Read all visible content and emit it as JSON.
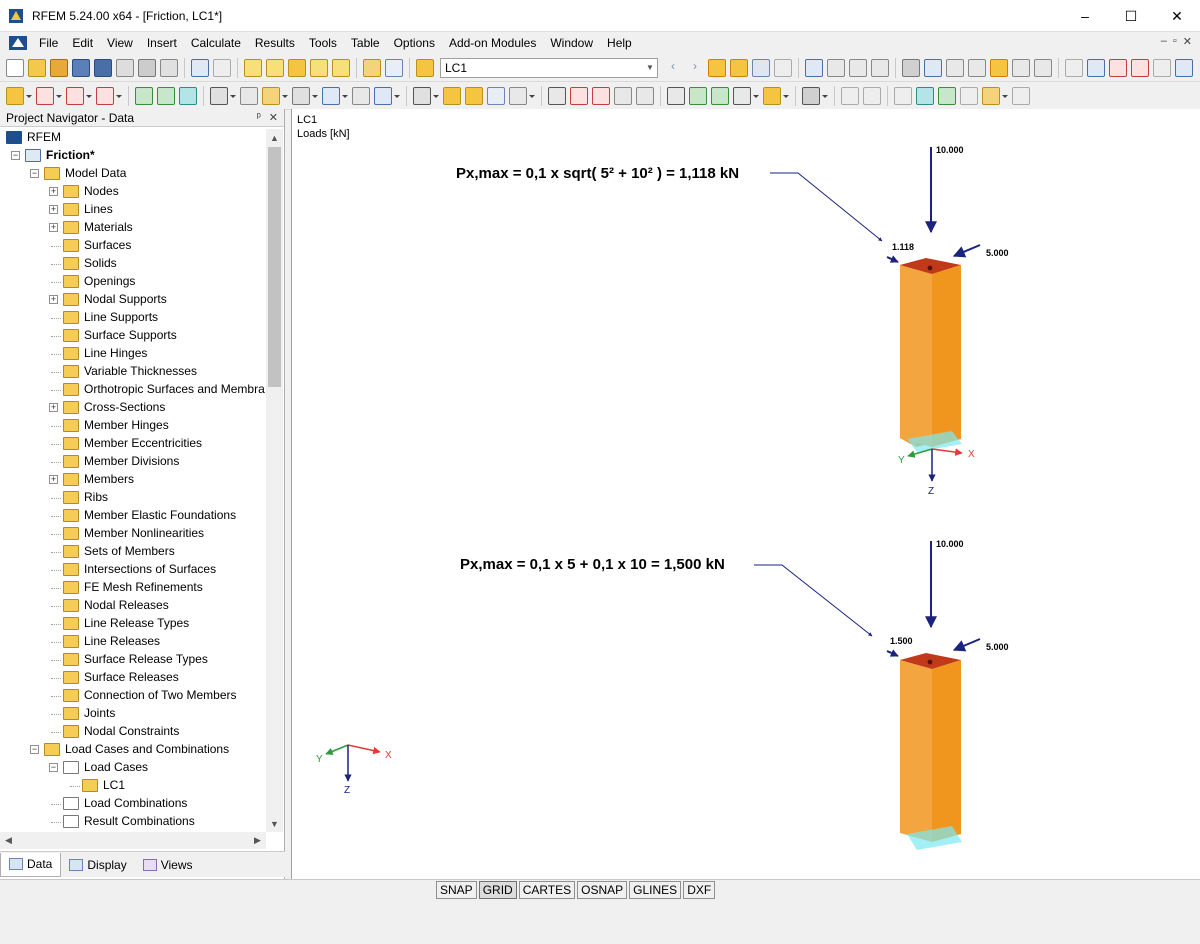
{
  "window": {
    "title": "RFEM 5.24.00 x64 - [Friction, LC1*]",
    "controls": [
      "–",
      "☐",
      "✕"
    ]
  },
  "menu": {
    "items": [
      "File",
      "Edit",
      "View",
      "Insert",
      "Calculate",
      "Results",
      "Tools",
      "Table",
      "Options",
      "Add-on Modules",
      "Window",
      "Help"
    ],
    "mdi": [
      "–",
      "▫",
      "✕"
    ]
  },
  "toolbar": {
    "load_case": "LC1"
  },
  "navigator": {
    "title": "Project Navigator - Data",
    "head_buttons": [
      "ᵖ",
      "✕"
    ],
    "tree": [
      {
        "label": "RFEM",
        "level": 0,
        "icon": "rfem-logo-icon",
        "expander": ""
      },
      {
        "label": "Friction*",
        "level": 1,
        "icon": "model-icon",
        "expander": "−",
        "bold": true
      },
      {
        "label": "Model Data",
        "level": 2,
        "icon": "folder-icon",
        "expander": "−"
      },
      {
        "label": "Nodes",
        "level": 3,
        "icon": "nodes-icon",
        "expander": "+"
      },
      {
        "label": "Lines",
        "level": 3,
        "icon": "lines-icon",
        "expander": "+"
      },
      {
        "label": "Materials",
        "level": 3,
        "icon": "materials-icon",
        "expander": "+"
      },
      {
        "label": "Surfaces",
        "level": 3,
        "icon": "surfaces-icon",
        "expander": ""
      },
      {
        "label": "Solids",
        "level": 3,
        "icon": "solids-icon",
        "expander": ""
      },
      {
        "label": "Openings",
        "level": 3,
        "icon": "openings-icon",
        "expander": ""
      },
      {
        "label": "Nodal Supports",
        "level": 3,
        "icon": "nodal-supports-icon",
        "expander": "+"
      },
      {
        "label": "Line Supports",
        "level": 3,
        "icon": "line-supports-icon",
        "expander": ""
      },
      {
        "label": "Surface Supports",
        "level": 3,
        "icon": "surface-supports-icon",
        "expander": ""
      },
      {
        "label": "Line Hinges",
        "level": 3,
        "icon": "line-hinges-icon",
        "expander": ""
      },
      {
        "label": "Variable Thicknesses",
        "level": 3,
        "icon": "variable-thickness-icon",
        "expander": ""
      },
      {
        "label": "Orthotropic Surfaces and Membra",
        "level": 3,
        "icon": "orthotropic-icon",
        "expander": ""
      },
      {
        "label": "Cross-Sections",
        "level": 3,
        "icon": "cross-sections-icon",
        "expander": "+"
      },
      {
        "label": "Member Hinges",
        "level": 3,
        "icon": "member-hinges-icon",
        "expander": ""
      },
      {
        "label": "Member Eccentricities",
        "level": 3,
        "icon": "member-eccentricities-icon",
        "expander": ""
      },
      {
        "label": "Member Divisions",
        "level": 3,
        "icon": "member-divisions-icon",
        "expander": ""
      },
      {
        "label": "Members",
        "level": 3,
        "icon": "members-icon",
        "expander": "+"
      },
      {
        "label": "Ribs",
        "level": 3,
        "icon": "ribs-icon",
        "expander": ""
      },
      {
        "label": "Member Elastic Foundations",
        "level": 3,
        "icon": "elastic-foundations-icon",
        "expander": ""
      },
      {
        "label": "Member Nonlinearities",
        "level": 3,
        "icon": "nonlinearities-icon",
        "expander": ""
      },
      {
        "label": "Sets of Members",
        "level": 3,
        "icon": "sets-of-members-icon",
        "expander": ""
      },
      {
        "label": "Intersections of Surfaces",
        "level": 3,
        "icon": "intersections-icon",
        "expander": ""
      },
      {
        "label": "FE Mesh Refinements",
        "level": 3,
        "icon": "fe-mesh-icon",
        "expander": ""
      },
      {
        "label": "Nodal Releases",
        "level": 3,
        "icon": "nodal-releases-icon",
        "expander": ""
      },
      {
        "label": "Line Release Types",
        "level": 3,
        "icon": "line-release-types-icon",
        "expander": ""
      },
      {
        "label": "Line Releases",
        "level": 3,
        "icon": "line-releases-icon",
        "expander": ""
      },
      {
        "label": "Surface Release Types",
        "level": 3,
        "icon": "surface-release-types-icon",
        "expander": ""
      },
      {
        "label": "Surface Releases",
        "level": 3,
        "icon": "surface-releases-icon",
        "expander": ""
      },
      {
        "label": "Connection of Two Members",
        "level": 3,
        "icon": "connection-icon",
        "expander": ""
      },
      {
        "label": "Joints",
        "level": 3,
        "icon": "joints-icon",
        "expander": ""
      },
      {
        "label": "Nodal Constraints",
        "level": 3,
        "icon": "nodal-constraints-icon",
        "expander": ""
      },
      {
        "label": "Load Cases and Combinations",
        "level": 2,
        "icon": "folder-icon",
        "expander": "−"
      },
      {
        "label": "Load Cases",
        "level": 3,
        "icon": "load-cases-icon",
        "expander": "−"
      },
      {
        "label": "LC1",
        "level": 4,
        "icon": "folder-icon",
        "expander": ""
      },
      {
        "label": "Load Combinations",
        "level": 3,
        "icon": "load-combinations-icon",
        "expander": ""
      },
      {
        "label": "Result Combinations",
        "level": 3,
        "icon": "result-combinations-icon",
        "expander": ""
      }
    ],
    "tabs": [
      {
        "label": "Data",
        "active": true
      },
      {
        "label": "Display",
        "active": false
      },
      {
        "label": "Views",
        "active": false
      }
    ]
  },
  "viewport": {
    "load_case": "LC1",
    "units": "Loads [kN]",
    "model1": {
      "formula": "Px,max = 0,1 x sqrt( 5² + 10² ) = 1,118 kN",
      "vertical_load": "10.000",
      "horizontal_load": "5.000",
      "friction_load": "1.118"
    },
    "model2": {
      "formula": "Px,max = 0,1 x 5 + 0,1 x 10 = 1,500 kN",
      "vertical_load": "10.000",
      "horizontal_load": "5.000",
      "friction_load": "1.500"
    },
    "axes": {
      "x": "X",
      "y": "Y",
      "z": "Z"
    },
    "colors": {
      "column": "#f0961e",
      "column_dark": "#c86414",
      "column_top": "#c03a1a",
      "load": "#1a237e",
      "support": "#60e8f0"
    }
  },
  "statusbar": {
    "toggles": [
      {
        "label": "SNAP",
        "on": false
      },
      {
        "label": "GRID",
        "on": true
      },
      {
        "label": "CARTES",
        "on": false
      },
      {
        "label": "OSNAP",
        "on": false
      },
      {
        "label": "GLINES",
        "on": false
      },
      {
        "label": "DXF",
        "on": false
      }
    ]
  }
}
